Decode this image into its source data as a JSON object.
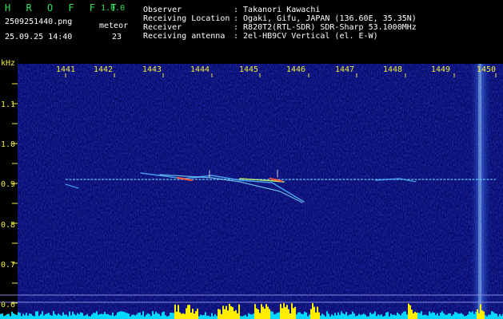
{
  "app": {
    "title": "H R O F F T",
    "version": "1.0.0"
  },
  "file": {
    "name": "2509251440.png",
    "timestamp": "25.09.25 14:40"
  },
  "meteor": {
    "label": "meteor",
    "count": "23"
  },
  "info": [
    {
      "key": "Observer",
      "value": ": Takanori Kawachi"
    },
    {
      "key": "Receiving Location",
      "value": ": Ogaki, Gifu, JAPAN (136.60E, 35.35N)"
    },
    {
      "key": "Receiver",
      "value": ": R820T2(RTL-SDR) SDR-Sharp 53.1000MHz"
    },
    {
      "key": "Receiving antenna",
      "value": ": 2el-HB9CV Vertical (el. E-W)"
    }
  ],
  "axis": {
    "y_unit": "kHz",
    "x_ticks": [
      "1441",
      "1442",
      "1443",
      "1444",
      "1445",
      "1446",
      "1447",
      "1448",
      "1449",
      "1450"
    ],
    "y_ticks": [
      "1.1",
      "1.0",
      "0.9",
      "0.8",
      "0.7",
      "0.6"
    ]
  },
  "colors": {
    "background": "#0a0a6a",
    "header_text": "#2fe05a",
    "tick_text": "#f2ec3c",
    "carrier": "#6fd0ff",
    "signal_bar": "#00d8ff",
    "signal_peak": "#ffee00"
  }
}
